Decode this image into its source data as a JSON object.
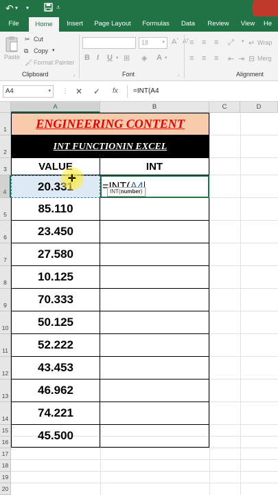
{
  "tabs": [
    "File",
    "Home",
    "Insert",
    "Page Layout",
    "Formulas",
    "Data",
    "Review",
    "View",
    "He"
  ],
  "active_tab": "Home",
  "ribbon": {
    "paste": "Paste",
    "cut": "Cut",
    "copy": "Copy",
    "format_painter": "Format Painter",
    "clipboard_group": "Clipboard",
    "font_size": "18",
    "font_group": "Font",
    "alignment_group": "Alignment",
    "wrap": "Wrap",
    "merge": "Merg"
  },
  "formula_bar": {
    "name_box": "A4",
    "fx": "fx",
    "formula": "=INT(A4"
  },
  "columns": [
    "A",
    "B",
    "C",
    "D"
  ],
  "rows": [
    "1",
    "2",
    "3",
    "4",
    "5",
    "6",
    "7",
    "8",
    "9",
    "10",
    "11",
    "12",
    "13",
    "14",
    "15",
    "16",
    "17",
    "18",
    "19",
    "20"
  ],
  "sheet": {
    "title": "ENGINEERING CONTENT",
    "subtitle": "INT FUNCTIONIN EXCEL",
    "header_value": "VALUE",
    "header_int": "INT",
    "values": [
      "20.331",
      "85.110",
      "23.450",
      "27.580",
      "10.125",
      "70.333",
      "50.125",
      "52.222",
      "43.453",
      "46.962",
      "74.221",
      "45.500"
    ],
    "editing_prefix": "=INT(",
    "editing_ref": "A4",
    "tooltip_fn": "INT(",
    "tooltip_arg": "number",
    "tooltip_close": ")"
  },
  "colors": {
    "excel_green": "#217346",
    "title_fill": "#f8cbad",
    "title_text": "#e00000",
    "ref_blue": "#2f6ab0"
  }
}
